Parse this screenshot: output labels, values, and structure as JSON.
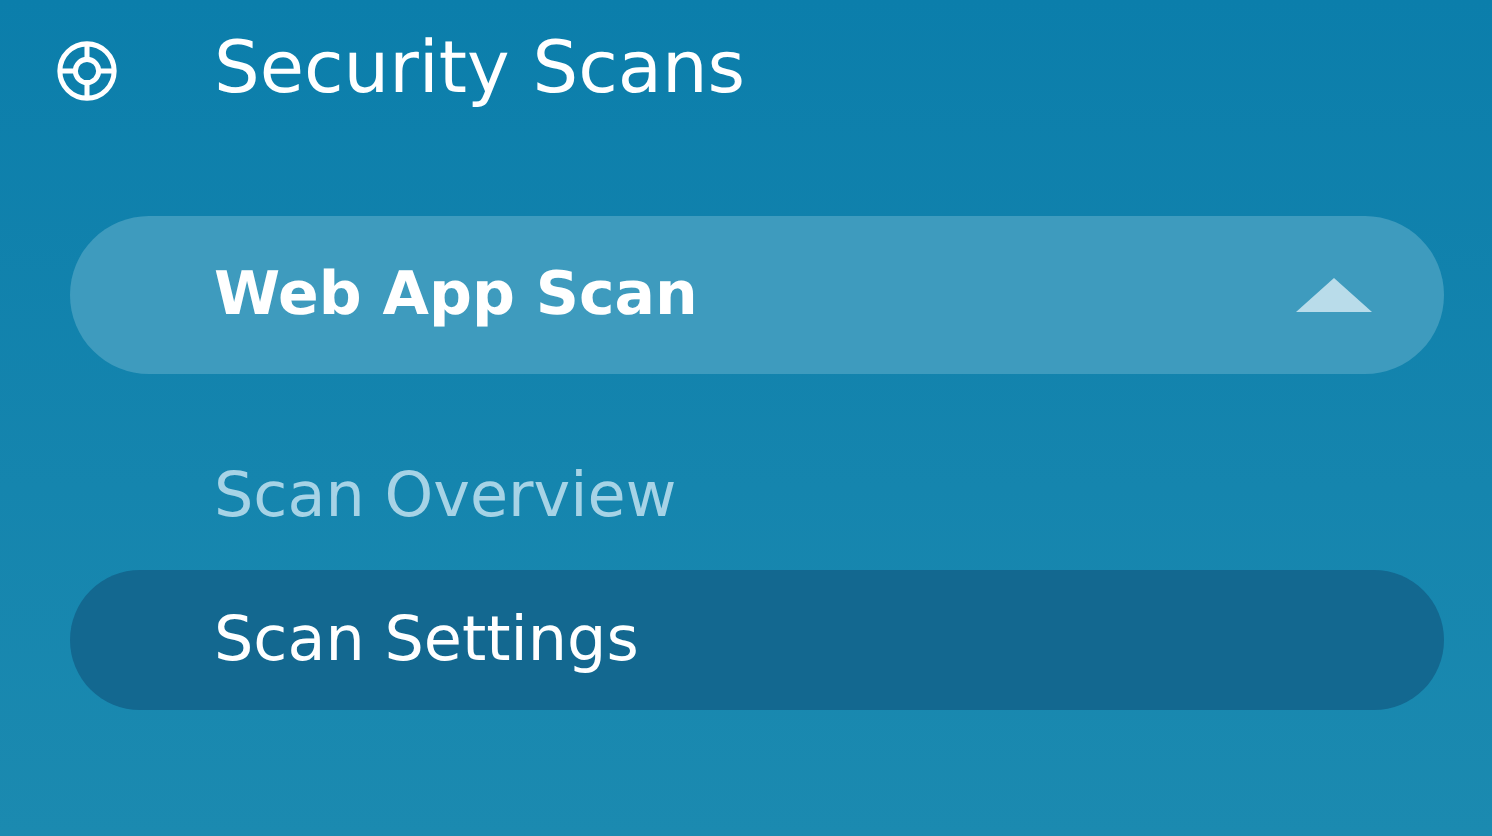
{
  "section": {
    "title": "Security Scans"
  },
  "group": {
    "label": "Web App Scan",
    "expanded": true
  },
  "items": [
    {
      "label": "Scan Overview",
      "selected": false
    },
    {
      "label": "Scan Settings",
      "selected": true
    }
  ]
}
